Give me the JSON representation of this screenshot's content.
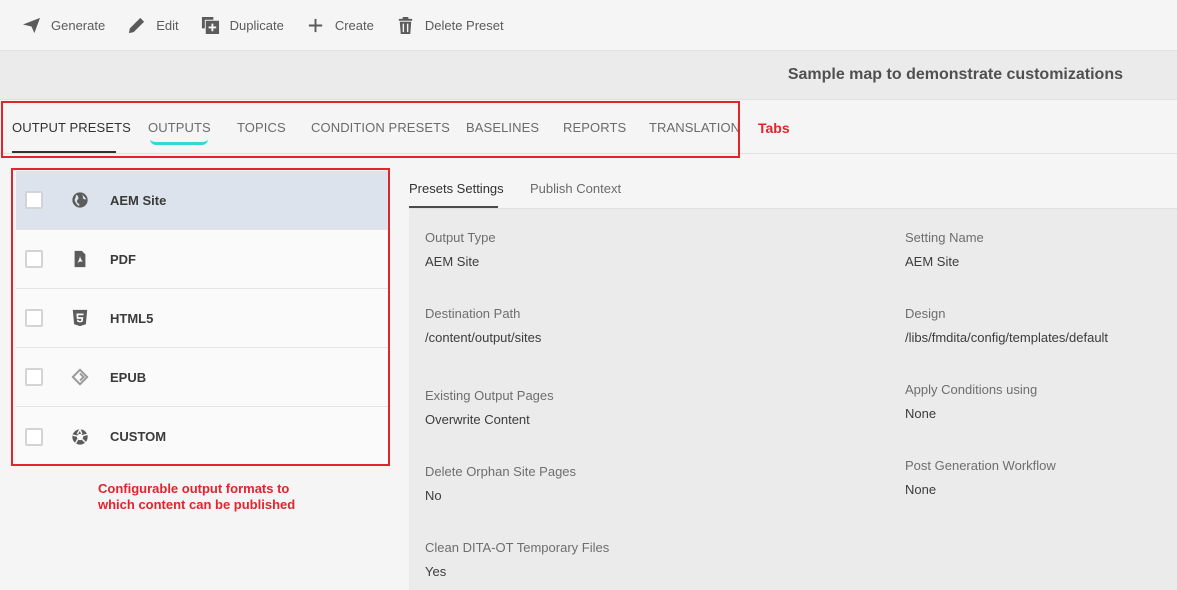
{
  "toolbar": {
    "generate": "Generate",
    "edit": "Edit",
    "duplicate": "Duplicate",
    "create": "Create",
    "delete_preset": "Delete Preset"
  },
  "map_title": "Sample map to demonstrate customizations",
  "tabs": [
    {
      "label": "OUTPUT PRESETS",
      "active": true
    },
    {
      "label": "OUTPUTS"
    },
    {
      "label": "TOPICS"
    },
    {
      "label": "CONDITION PRESETS"
    },
    {
      "label": "BASELINES"
    },
    {
      "label": "REPORTS"
    },
    {
      "label": "TRANSLATION"
    }
  ],
  "annotations": {
    "tabs": "Tabs",
    "list_line1": "Configurable output formats to",
    "list_line2": "which content can be published",
    "color": "#e0252b",
    "highlight_color": "#35d6d6"
  },
  "presets": [
    {
      "label": "AEM Site",
      "icon": "globe-icon",
      "selected": true
    },
    {
      "label": "PDF",
      "icon": "pdf-icon"
    },
    {
      "label": "HTML5",
      "icon": "html5-icon"
    },
    {
      "label": "EPUB",
      "icon": "epub-icon"
    },
    {
      "label": "CUSTOM",
      "icon": "aperture-icon"
    }
  ],
  "sub_tabs": [
    {
      "label": "Presets Settings",
      "active": true
    },
    {
      "label": "Publish Context"
    }
  ],
  "settings": {
    "output_type": {
      "label": "Output Type",
      "value": "AEM Site"
    },
    "setting_name": {
      "label": "Setting Name",
      "value": "AEM Site"
    },
    "destination_path": {
      "label": "Destination Path",
      "value": "/content/output/sites"
    },
    "design": {
      "label": "Design",
      "value": "/libs/fmdita/config/templates/default"
    },
    "existing_output_pages": {
      "label": "Existing Output Pages",
      "value": "Overwrite Content"
    },
    "apply_conditions": {
      "label": "Apply Conditions using",
      "value": "None"
    },
    "delete_orphan": {
      "label": "Delete Orphan Site Pages",
      "value": "No"
    },
    "post_generation": {
      "label": "Post Generation Workflow",
      "value": "None"
    },
    "clean_temp": {
      "label": "Clean DITA-OT Temporary Files",
      "value": "Yes"
    }
  }
}
